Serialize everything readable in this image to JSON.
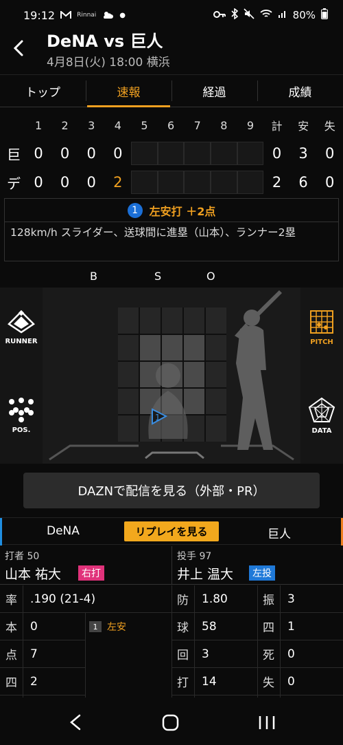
{
  "status": {
    "time": "19:12",
    "rinnai": "Rinnai",
    "battery": "80%"
  },
  "header": {
    "title": "DeNA vs 巨人",
    "subtitle": "4月8日(火) 18:00 横浜"
  },
  "tabs": [
    {
      "label": "トップ",
      "active": false
    },
    {
      "label": "速報",
      "active": true
    },
    {
      "label": "経過",
      "active": false
    },
    {
      "label": "成績",
      "active": false
    }
  ],
  "scoreboard": {
    "innings": [
      "1",
      "2",
      "3",
      "4",
      "5",
      "6",
      "7",
      "8",
      "9"
    ],
    "total_headers": [
      "計",
      "安",
      "失"
    ],
    "teams": [
      {
        "abbr": "巨",
        "innings": [
          "0",
          "0",
          "0",
          "0",
          "",
          "",
          "",
          "",
          ""
        ],
        "totals": [
          "0",
          "3",
          "0"
        ]
      },
      {
        "abbr": "デ",
        "innings": [
          "0",
          "0",
          "0",
          "2",
          "",
          "",
          "",
          "",
          ""
        ],
        "totals": [
          "2",
          "6",
          "0"
        ]
      }
    ]
  },
  "play": {
    "number": "1",
    "title": "左安打 ＋2点",
    "description": "128km/h スライダー、送球間に進塁（山本）、ランナー2塁"
  },
  "count_labels": {
    "b": "B",
    "s": "S",
    "o": "O"
  },
  "side_buttons": {
    "runner": "RUNNER",
    "pos": "POS.",
    "pitch": "PITCH",
    "data": "DATA"
  },
  "pitch_marker": {
    "number": "1",
    "zone_row": 3,
    "zone_col": 1
  },
  "dazn_label": "DAZNで配信を見る（外部・PR）",
  "teams_bar": {
    "home": "DeNA",
    "replay": "リプレイを見る",
    "away": "巨人"
  },
  "batter": {
    "label": "打者 50",
    "name": "山本 祐大",
    "tag": "右打"
  },
  "pitcher": {
    "label": "投手 97",
    "name": "井上 温大",
    "tag": "左投"
  },
  "batter_stats": [
    {
      "k": "率",
      "v": ".190 (21-4)"
    },
    {
      "k": "本",
      "v": "0"
    },
    {
      "k": "点",
      "v": "7"
    },
    {
      "k": "四",
      "v": "2"
    }
  ],
  "at_bat_result": {
    "n": "1",
    "text": "左安"
  },
  "pitcher_stats": [
    {
      "k": "防",
      "v": "1.80",
      "k2": "振",
      "v2": "3"
    },
    {
      "k": "球",
      "v": "58",
      "k2": "四",
      "v2": "1"
    },
    {
      "k": "回",
      "v": "3",
      "k2": "死",
      "v2": "0"
    },
    {
      "k": "打",
      "v": "14",
      "k2": "失",
      "v2": "0"
    }
  ],
  "colors": {
    "accent": "#f0a020",
    "batter_tag": "#e0327a",
    "pitcher_tag": "#1f79d8",
    "home_edge": "#1f8ee0",
    "away_edge": "#f08020"
  }
}
